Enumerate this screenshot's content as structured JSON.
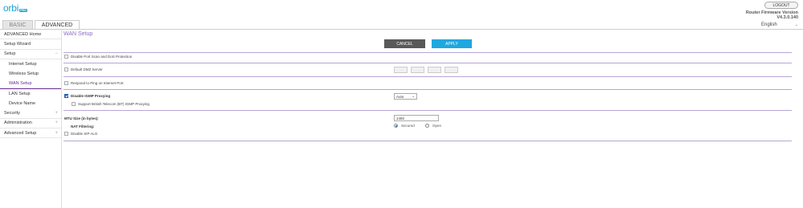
{
  "header": {
    "logo_text": "orbi",
    "logo_badge": "PRO",
    "logout_label": "LOGOUT",
    "firmware_label": "Router Firmware Version",
    "firmware_version": "V4.3.0.140",
    "language": "English"
  },
  "tabs": {
    "basic": "BASIC",
    "advanced": "ADVANCED"
  },
  "sidebar": {
    "advanced_home": "ADVANCED Home",
    "setup_wizard": "Setup Wizard",
    "setup": "Setup",
    "setup_toggle": "−",
    "internet_setup": "Internet Setup",
    "wireless_setup": "Wireless Setup",
    "wan_setup": "WAN Setup",
    "lan_setup": "LAN Setup",
    "device_name": "Device Name",
    "security": "Security",
    "administration": "Administration",
    "advanced_setup": "Advanced Setup",
    "expand_symbol": "+"
  },
  "main": {
    "title": "WAN Setup",
    "cancel_label": "CANCEL",
    "apply_label": "APPLY",
    "disable_port_scan": "Disable Port Scan and DoS Protection",
    "default_dmz": "Default DMZ Server",
    "respond_ping": "Respond to Ping on Internet Port",
    "disable_igmp": "Disable IGMP Proxying",
    "igmp_mode": "Auto",
    "support_bt_igmp": "Support British Telecom (BT) IGMP Proxying",
    "mtu_label": "MTU Size (in bytes):",
    "mtu_value": "1492",
    "nat_label": "NAT Filtering:",
    "nat_secured": "Secured",
    "nat_open": "Open",
    "disable_sip_alg": "Disable SIP ALG"
  },
  "colors": {
    "accent": "#1ea8e0",
    "purple": "#662d91",
    "divider": "#b7a6d6"
  }
}
